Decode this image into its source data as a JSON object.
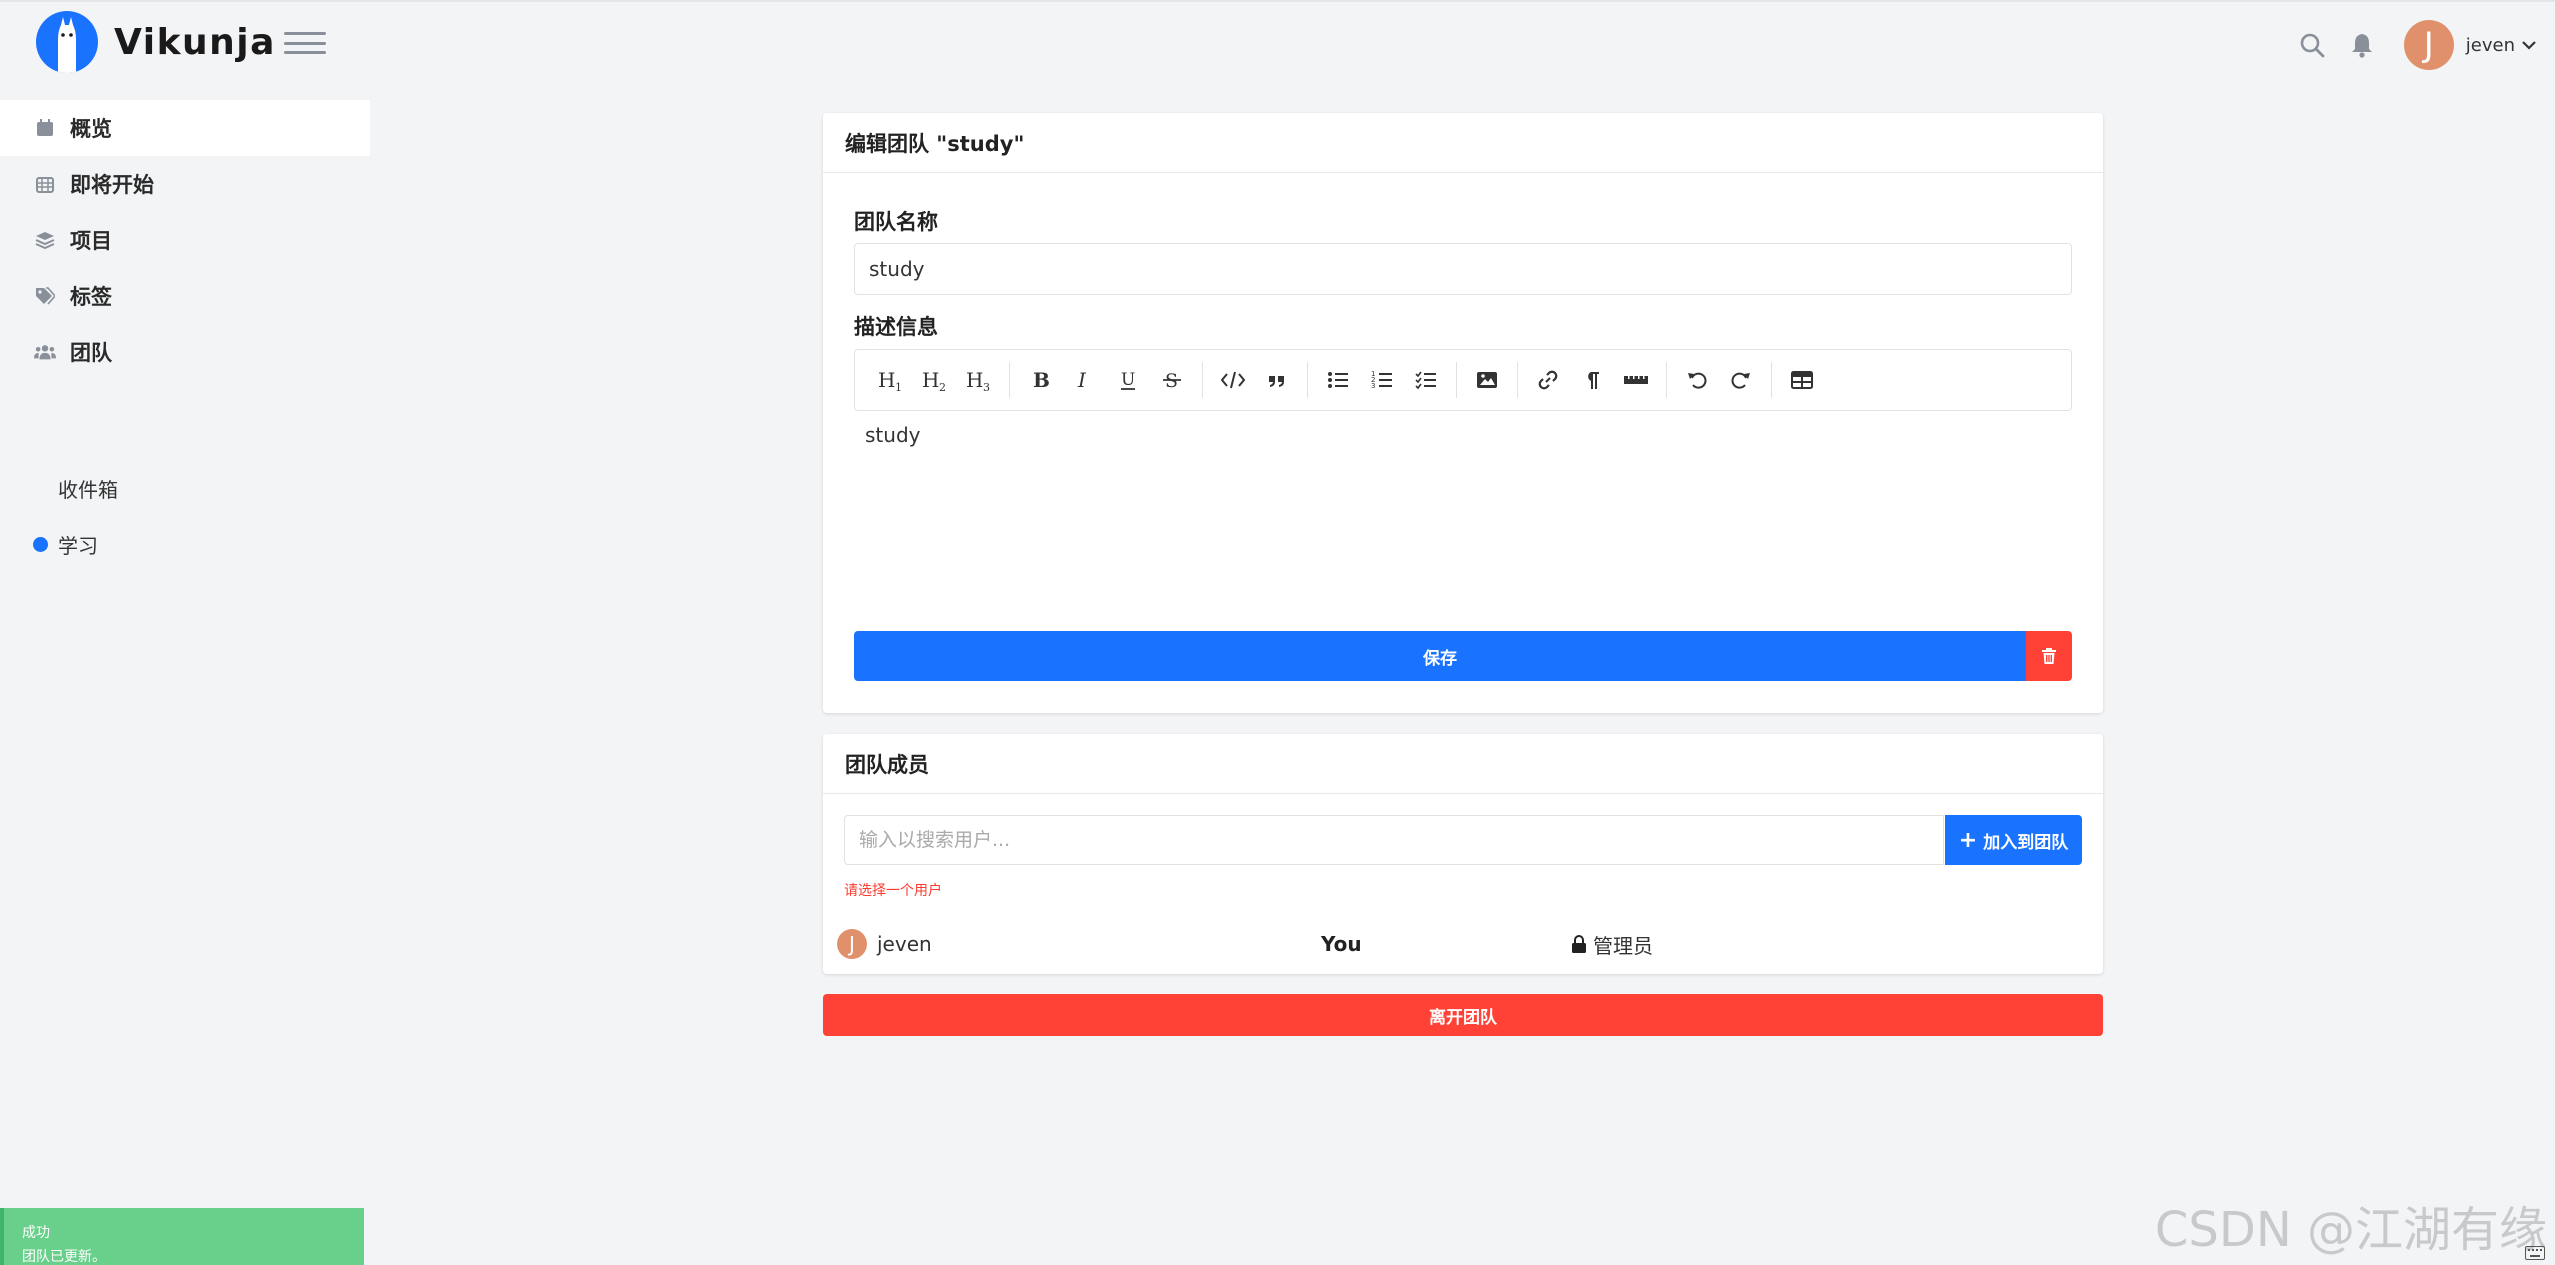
{
  "app": {
    "name": "Vikunja"
  },
  "header": {
    "user_name": "jeven",
    "avatar_letter": "J"
  },
  "sidebar": {
    "items": [
      {
        "label": "概览",
        "icon": "calendar-icon"
      },
      {
        "label": "即将开始",
        "icon": "calendar-grid-icon"
      },
      {
        "label": "项目",
        "icon": "layers-icon"
      },
      {
        "label": "标签",
        "icon": "tags-icon"
      },
      {
        "label": "团队",
        "icon": "users-icon"
      }
    ],
    "projects": [
      {
        "label": "收件箱"
      },
      {
        "label": "学习",
        "color": "#1973ff"
      }
    ]
  },
  "edit_team": {
    "title": "编辑团队 \"study\"",
    "name_label": "团队名称",
    "name_value": "study",
    "description_label": "描述信息",
    "description_value": "study",
    "save_label": "保存"
  },
  "members": {
    "title": "团队成员",
    "search_placeholder": "输入以搜索用户...",
    "join_label": "加入到团队",
    "error": "请选择一个用户",
    "rows": [
      {
        "avatar_letter": "J",
        "name": "jeven",
        "you": "You",
        "role": "管理员"
      }
    ]
  },
  "leave_label": "离开团队",
  "toast": {
    "title": "成功",
    "message": "团队已更新。"
  },
  "watermark": "CSDN @江湖有缘",
  "colors": {
    "primary": "#1973ff",
    "danger": "#ff4136",
    "success": "#68d08b",
    "avatar": "#e0916b"
  }
}
